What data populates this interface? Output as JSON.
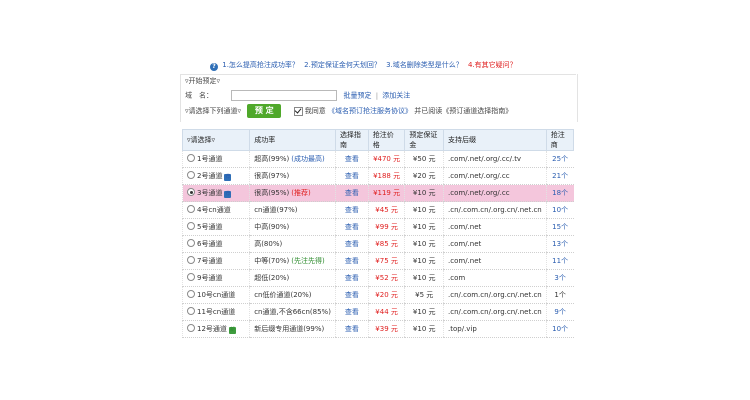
{
  "faq": {
    "items": [
      {
        "text": "1.怎么提高抢注成功率？",
        "color": "#2a5db0"
      },
      {
        "text": "2.预定保证金何天划回？",
        "color": "#2a5db0"
      },
      {
        "text": "3.域名删除类型是什么？",
        "color": "#2a5db0"
      },
      {
        "text": "4.有其它疑问？",
        "color": "#e02020"
      }
    ]
  },
  "form": {
    "legend": "▿开始预定▿",
    "domain_label": "域　名：",
    "domain_value": "",
    "bulk_link": "批量预定",
    "separator": "|",
    "add_focus_link": "添加关注",
    "choose_label": "▿请选择下列通道▿",
    "book_button": "预 定",
    "agree_prefix": "我同意",
    "agreement_link": "《域名预订抢注服务协议》",
    "agree_suffix": "并已阅读《预订通道选择指南》"
  },
  "table": {
    "headers": [
      "▿请选择▿",
      "成功率",
      "选择指南",
      "抢注价格",
      "预定保证金",
      "支持后缀",
      "抢注商"
    ],
    "rows": [
      {
        "channel": "1号通道",
        "badge": "",
        "rate": "超高(99%)",
        "note": "(成功最高)",
        "note_color": "blue",
        "guide": "查看",
        "price": "¥470 元",
        "deposit": "¥50 元",
        "suffix": ".com/.net/.org/.cc/.tv",
        "count": "25个",
        "count_blue": true,
        "highlight": false,
        "selected": false
      },
      {
        "channel": "2号通道",
        "badge": "荐",
        "badge_color": "blue",
        "rate": "很高(97%)",
        "note": "",
        "guide": "查看",
        "price": "¥188 元",
        "deposit": "¥20 元",
        "suffix": ".com/.net/.org/.cc",
        "count": "21个",
        "count_blue": true,
        "highlight": false,
        "selected": false
      },
      {
        "channel": "3号通道",
        "badge": "荐",
        "badge_color": "blue",
        "rate": "很高(95%)",
        "note": "(推荐)",
        "note_color": "red",
        "guide": "查看",
        "price": "¥119 元",
        "deposit": "¥10 元",
        "suffix": ".com/.net/.org/.cc",
        "count": "18个",
        "count_blue": true,
        "highlight": true,
        "selected": true
      },
      {
        "channel": "4号cn通道",
        "badge": "",
        "rate": "cn通道(97%)",
        "note": "",
        "guide": "查看",
        "price": "¥45 元",
        "deposit": "¥10 元",
        "suffix": ".cn/.com.cn/.org.cn/.net.cn",
        "count": "10个",
        "count_blue": true,
        "highlight": false,
        "selected": false
      },
      {
        "channel": "5号通道",
        "badge": "",
        "rate": "中高(90%)",
        "note": "",
        "guide": "查看",
        "price": "¥99 元",
        "deposit": "¥10 元",
        "suffix": ".com/.net",
        "count": "15个",
        "count_blue": true,
        "highlight": false,
        "selected": false
      },
      {
        "channel": "6号通道",
        "badge": "",
        "rate": "高(80%)",
        "note": "",
        "guide": "查看",
        "price": "¥85 元",
        "deposit": "¥10 元",
        "suffix": ".com/.net",
        "count": "13个",
        "count_blue": true,
        "highlight": false,
        "selected": false
      },
      {
        "channel": "7号通道",
        "badge": "",
        "rate": "中等(70%)",
        "note": "(先注先得)",
        "note_color": "green",
        "guide": "查看",
        "price": "¥75 元",
        "deposit": "¥10 元",
        "suffix": ".com/.net",
        "count": "11个",
        "count_blue": true,
        "highlight": false,
        "selected": false
      },
      {
        "channel": "9号通道",
        "badge": "",
        "rate": "超低(20%)",
        "note": "",
        "guide": "查看",
        "price": "¥52 元",
        "deposit": "¥10 元",
        "suffix": ".com",
        "count": "3个",
        "count_blue": true,
        "highlight": false,
        "selected": false
      },
      {
        "channel": "10号cn通道",
        "badge": "",
        "rate": "cn低价通道(20%)",
        "note": "",
        "guide": "查看",
        "price": "¥20 元",
        "deposit": "¥5 元",
        "suffix": ".cn/.com.cn/.org.cn/.net.cn",
        "count": "1个",
        "count_blue": false,
        "highlight": false,
        "selected": false
      },
      {
        "channel": "11号cn通道",
        "badge": "",
        "rate": "cn通道,不含66cn(85%)",
        "note": "",
        "guide": "查看",
        "price": "¥44 元",
        "deposit": "¥10 元",
        "suffix": ".cn/.com.cn/.org.cn/.net.cn",
        "count": "9个",
        "count_blue": true,
        "highlight": false,
        "selected": false
      },
      {
        "channel": "12号通道",
        "badge": "新",
        "badge_color": "green",
        "rate": "新后缀专用通道(99%)",
        "note": "",
        "guide": "查看",
        "price": "¥39 元",
        "deposit": "¥10 元",
        "suffix": ".top/.vip",
        "count": "10个",
        "count_blue": true,
        "highlight": false,
        "selected": false
      }
    ]
  }
}
